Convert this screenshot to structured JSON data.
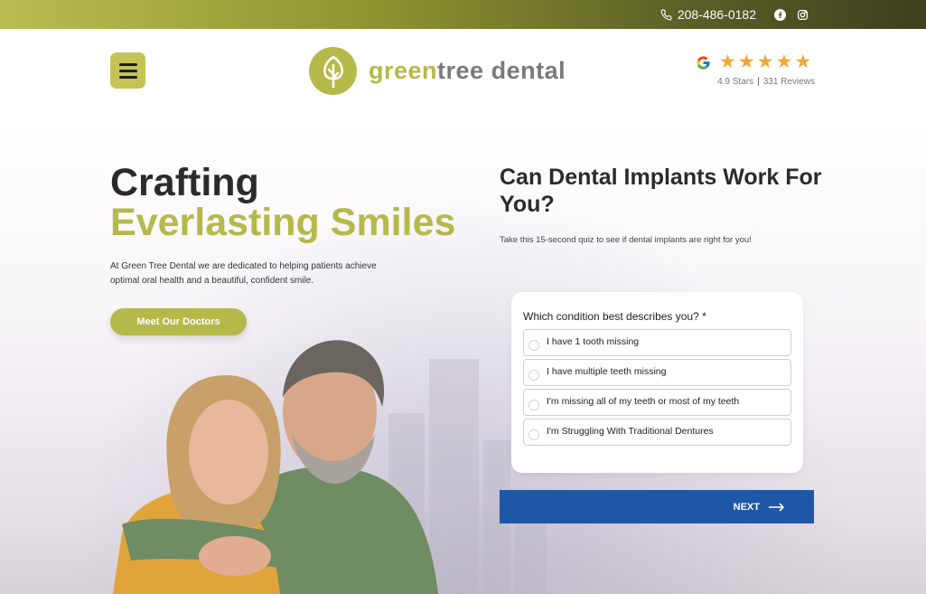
{
  "topbar": {
    "phone": "208-486-0182",
    "social": [
      "facebook-icon",
      "instagram-icon"
    ]
  },
  "logo": {
    "part1": "green",
    "part2": "tree",
    "part3": "dental"
  },
  "reviews": {
    "rating": "4.9 Stars",
    "count": "331 Reviews",
    "stars": 5
  },
  "hero": {
    "title_line1": "Crafting",
    "title_line2": "Everlasting Smiles",
    "description": "At Green Tree Dental we are dedicated to helping patients achieve optimal oral health and a beautiful, confident smile.",
    "cta_label": "Meet Our Doctors"
  },
  "quiz": {
    "title": "Can Dental Implants Work For You?",
    "subtitle": "Take this 15-second quiz to see if dental implants are right for you!",
    "question": "Which condition best describes you? *",
    "options": [
      "I have 1 tooth missing",
      "I have multiple teeth missing",
      "I'm missing all of my teeth or most of my teeth",
      "I'm Struggling With Traditional Dentures"
    ],
    "next_label": "NEXT"
  },
  "colors": {
    "brand_green": "#b5b94a",
    "next_blue": "#1f57a6",
    "star": "#f0a83c"
  }
}
